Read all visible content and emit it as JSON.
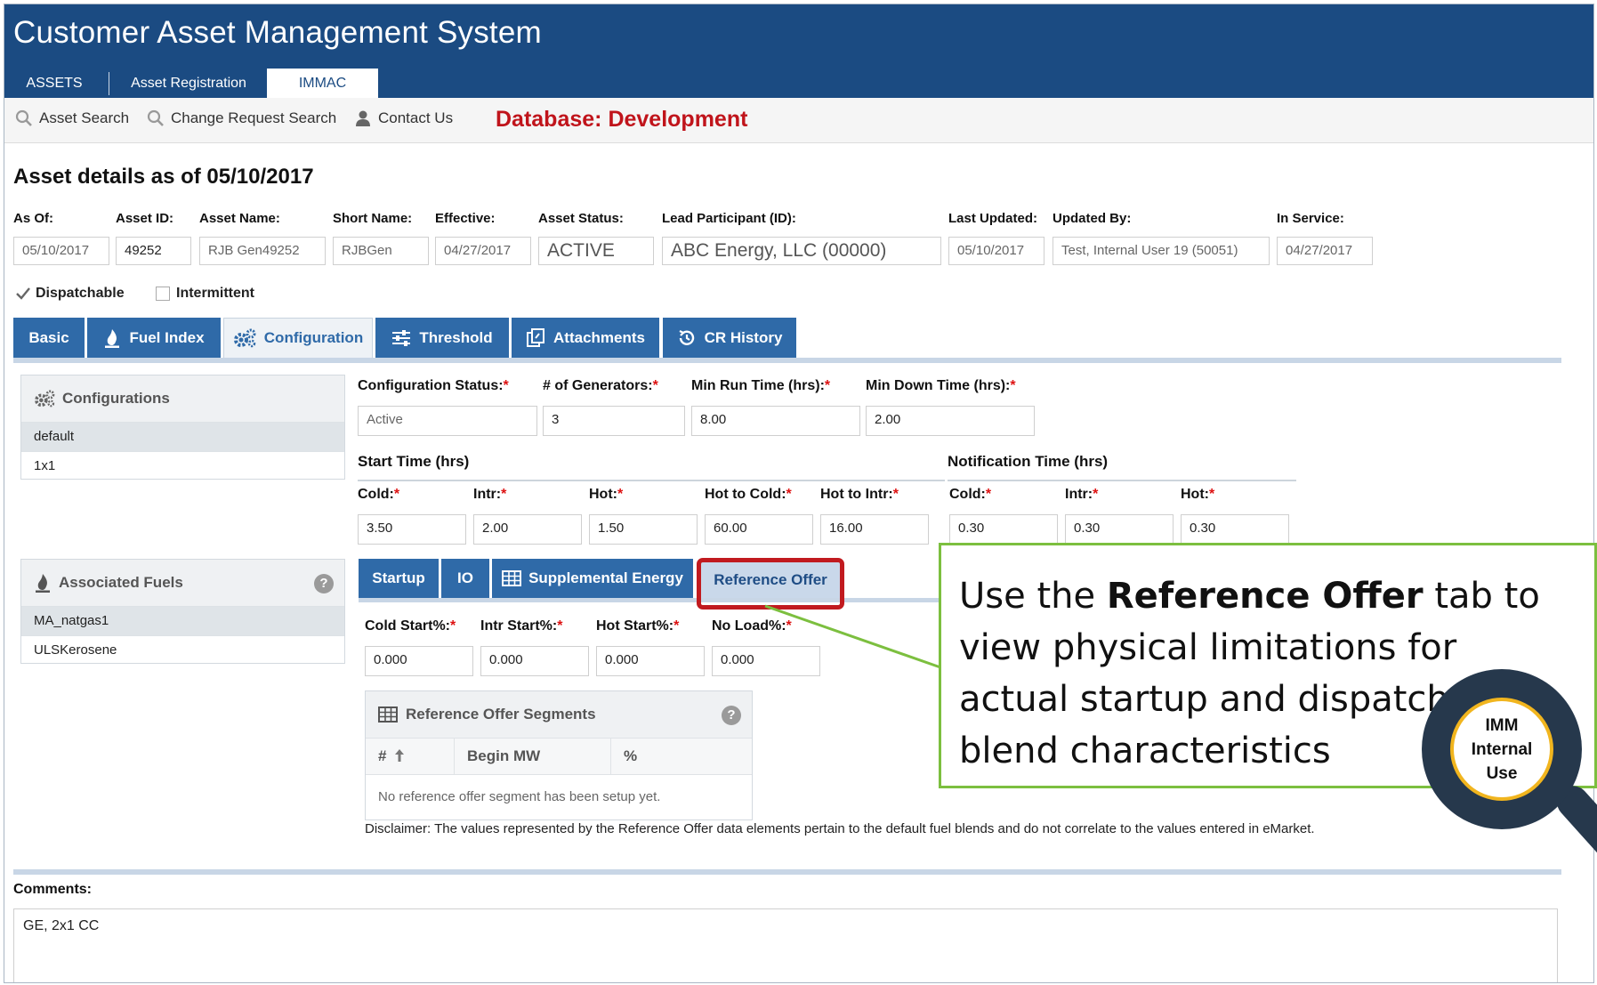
{
  "app_title": "Customer Asset Management System",
  "main_tabs": [
    "ASSETS",
    "Asset Registration",
    "IMMAC"
  ],
  "subnav": {
    "asset_search": "Asset Search",
    "change_request_search": "Change Request Search",
    "contact_us": "Contact Us",
    "database": "Database: Development"
  },
  "page_title": "Asset details as of 05/10/2017",
  "asset": {
    "as_of": {
      "label": "As Of:",
      "value": "05/10/2017"
    },
    "asset_id": {
      "label": "Asset ID:",
      "value": "49252"
    },
    "asset_name": {
      "label": "Asset Name:",
      "value": "RJB Gen49252"
    },
    "short_name": {
      "label": "Short Name:",
      "value": "RJBGen"
    },
    "effective": {
      "label": "Effective:",
      "value": "04/27/2017"
    },
    "asset_status": {
      "label": "Asset Status:",
      "value": "ACTIVE"
    },
    "lead_participant": {
      "label": "Lead Participant (ID):",
      "value": "ABC Energy, LLC (00000)"
    },
    "last_updated": {
      "label": "Last Updated:",
      "value": "05/10/2017"
    },
    "updated_by": {
      "label": "Updated By:",
      "value": "Test, Internal User 19 (50051)"
    },
    "in_service": {
      "label": "In Service:",
      "value": "04/27/2017"
    }
  },
  "checks": {
    "dispatchable": {
      "label": "Dispatchable",
      "checked": true
    },
    "intermittent": {
      "label": "Intermittent",
      "checked": false
    }
  },
  "section_tabs": [
    "Basic",
    "Fuel Index",
    "Configuration",
    "Threshold",
    "Attachments",
    "CR History"
  ],
  "configurations": {
    "title": "Configurations",
    "items": [
      "default",
      "1x1"
    ]
  },
  "associated_fuels": {
    "title": "Associated Fuels",
    "help": "?",
    "items": [
      "MA_natgas1",
      "ULSKerosene"
    ]
  },
  "config_fields": {
    "status": {
      "label": "Configuration Status:",
      "value": "Active"
    },
    "generators": {
      "label": "# of Generators:",
      "value": "3"
    },
    "min_run": {
      "label": "Min Run Time (hrs):",
      "value": "8.00"
    },
    "min_down": {
      "label": "Min Down Time (hrs):",
      "value": "2.00"
    }
  },
  "required_mark": "*",
  "start_time": {
    "title": "Start Time (hrs)",
    "cold": {
      "label": "Cold:",
      "value": "3.50"
    },
    "intr": {
      "label": "Intr:",
      "value": "2.00"
    },
    "hot": {
      "label": "Hot:",
      "value": "1.50"
    },
    "hot_to_cold": {
      "label": "Hot to Cold:",
      "value": "60.00"
    },
    "hot_to_intr": {
      "label": "Hot to Intr:",
      "value": "16.00"
    }
  },
  "notification_time": {
    "title": "Notification Time (hrs)",
    "cold": {
      "label": "Cold:",
      "value": "0.30"
    },
    "intr": {
      "label": "Intr:",
      "value": "0.30"
    },
    "hot": {
      "label": "Hot:",
      "value": "0.30"
    }
  },
  "inner_tabs": [
    "Startup",
    "IO",
    "Supplemental Energy",
    "Reference Offer"
  ],
  "reference_offer": {
    "cold_start": {
      "label": "Cold Start%:",
      "value": "0.000"
    },
    "intr_start": {
      "label": "Intr Start%:",
      "value": "0.000"
    },
    "hot_start": {
      "label": "Hot Start%:",
      "value": "0.000"
    },
    "no_load": {
      "label": "No Load%:",
      "value": "0.000"
    }
  },
  "segments": {
    "title": "Reference Offer Segments",
    "help": "?",
    "columns": [
      "#",
      "Begin MW",
      "%"
    ],
    "empty": "No reference offer segment has been setup yet."
  },
  "disclaimer": "Disclaimer: The values represented by the Reference Offer data elements pertain to the default fuel blends and do not correlate to the values entered in eMarket.",
  "comments": {
    "label": "Comments:",
    "value": "GE, 2x1 CC"
  },
  "callout": {
    "pre": "Use the ",
    "bold": "Reference Offer",
    "post": " tab to view physical limitations for actual startup and dispatch fuel blend characteristics"
  },
  "badge": [
    "IMM",
    "Internal",
    "Use"
  ],
  "colors": {
    "header": "#1b4b82",
    "tab": "#2f6aa8",
    "database": "#c0141b",
    "callout_border": "#7cbf3f",
    "highlight": "#c11a1f"
  }
}
